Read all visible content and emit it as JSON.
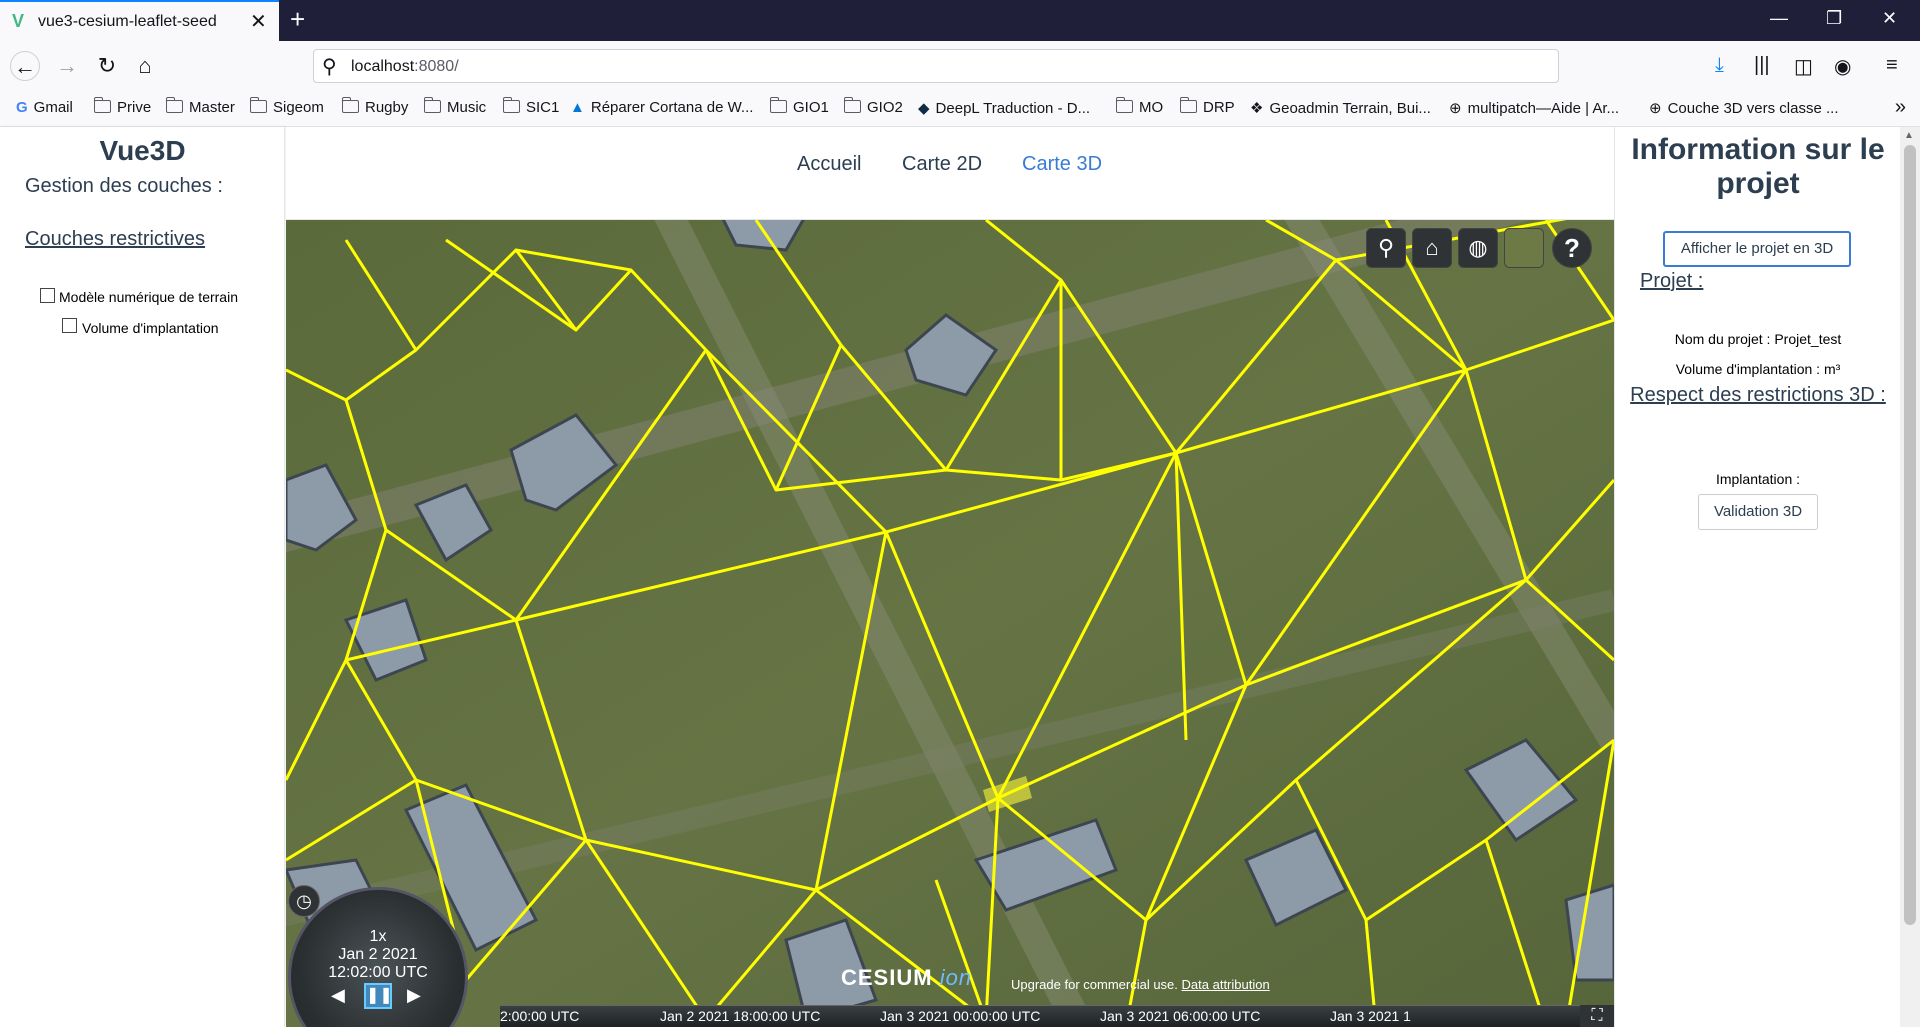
{
  "browser": {
    "tab_title": "vue3-cesium-leaflet-seed",
    "url_host": "localhost",
    "url_rest": ":8080/",
    "bookmarks": [
      "Gmail",
      "Prive",
      "Master",
      "Sigeom",
      "Rugby",
      "Music",
      "SIC1",
      "Réparer Cortana de W...",
      "GIO1",
      "GIO2",
      "DeepL Traduction - D...",
      "MO",
      "DRP",
      "Geoadmin Terrain, Bui...",
      "multipatch—Aide | Ar...",
      "Couche 3D vers classe ..."
    ]
  },
  "left": {
    "title": "Vue3D",
    "subtitle": "Gestion des couches :",
    "section_link": "Couches restrictives",
    "layers": [
      {
        "label": "Modèle numérique de terrain",
        "checked": false
      },
      {
        "label": "Volume d'implantation",
        "checked": false
      }
    ]
  },
  "nav": {
    "links": [
      "Accueil",
      "Carte 2D",
      "Carte 3D"
    ],
    "active": "Carte 3D"
  },
  "map": {
    "toolbar_icons": [
      "search-icon",
      "home-icon",
      "globe-icon",
      "imagery-layers-icon",
      "help-icon"
    ],
    "clock": {
      "speed": "1x",
      "date": "Jan 2 2021",
      "time": "12:02:00 UTC"
    },
    "timeline_labels": [
      "2:00:00 UTC",
      "Jan 2 2021 18:00:00 UTC",
      "Jan 3 2021 00:00:00 UTC",
      "Jan 3 2021 06:00:00 UTC",
      "Jan 3 2021 1"
    ],
    "logo": "CESIUM",
    "logo_suffix": "ion",
    "attribution_text": "Upgrade for commercial use.",
    "attribution_link": "Data attribution"
  },
  "right": {
    "title": "Information sur le projet",
    "show3d_button": "Afficher le projet en 3D",
    "projet_heading": "Projet :",
    "project_name": "Nom du projet : Projet_test",
    "volume": "Volume d'implantation : m³",
    "restrictions_heading": "Respect des restrictions 3D :",
    "implantation_label": "Implantation :",
    "validation_button": "Validation 3D"
  },
  "colors": {
    "accent": "#3a7bd5",
    "wireframe": "#ffff00",
    "heading": "#2c3e50"
  }
}
